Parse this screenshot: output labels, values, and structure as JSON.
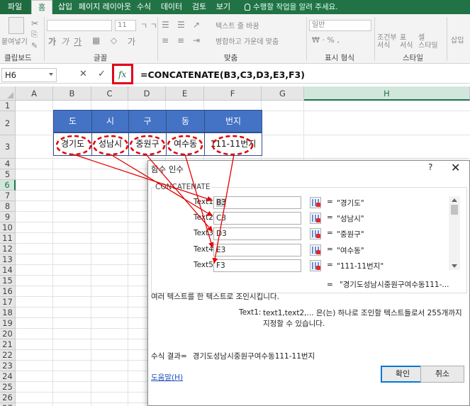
{
  "ribbon": {
    "tabs": [
      "파일",
      "홈",
      "삽입",
      "페이지 레이아웃",
      "수식",
      "데이터",
      "검토",
      "보기"
    ],
    "tell_me": "수행할 작업을 알려 주세요.",
    "font_name": "",
    "font_size": "11",
    "wrap_text": "텍스트 줄 바꿈",
    "merge_center": "병합하고 가운데 맞춤",
    "number_format": "일반",
    "paste": "붙여넣기",
    "conditional_format": "조건부\n서식",
    "format_as_table": "표\n서식",
    "cell_styles": "셀\n스타일",
    "insert": "삽입",
    "groups": {
      "clipboard": "클립보드",
      "font": "글꼴",
      "alignment": "맞춤",
      "number": "표시 형식",
      "styles": "스타일"
    }
  },
  "formula_bar": {
    "name_box": "H6",
    "cancel": "✕",
    "enter": "✓",
    "fx": "fx",
    "formula": "=CONCATENATE(B3,C3,D3,E3,F3)"
  },
  "sheet": {
    "columns": [
      "A",
      "B",
      "C",
      "D",
      "E",
      "F",
      "G",
      "H"
    ],
    "rows": [
      "1",
      "2",
      "3",
      "4",
      "5",
      "6",
      "7",
      "8",
      "9",
      "10",
      "11",
      "12",
      "13",
      "14",
      "15",
      "16",
      "17",
      "18",
      "19",
      "20",
      "21",
      "22",
      "23",
      "24",
      "25",
      "26",
      "27"
    ],
    "table_headers": [
      "도",
      "시",
      "구",
      "동",
      "번지"
    ],
    "table_values": [
      "경기도",
      "성남시",
      "중원구",
      "여수동",
      "111-11번지"
    ],
    "selected_cell": "H6",
    "accent": "#4472c4"
  },
  "dialog": {
    "title": "함수 인수",
    "help": "?",
    "close": "✕",
    "function_name": "CONCATENATE",
    "args": [
      {
        "label": "Text1",
        "ref": "B3",
        "value": "\"경기도\""
      },
      {
        "label": "Text2",
        "ref": "C3",
        "value": "\"성남시\""
      },
      {
        "label": "Text3",
        "ref": "D3",
        "value": "\"중원구\""
      },
      {
        "label": "Text4",
        "ref": "E3",
        "value": "\"여수동\""
      },
      {
        "label": "Text5",
        "ref": "F3",
        "value": "\"111-11번지\""
      }
    ],
    "equals": "=",
    "result_preview": "\"경기도성남시중원구여수동111-...",
    "description": "여러 텍스트를 한 텍스트로 조인시킵니다.",
    "arg_desc_name": "Text1:",
    "arg_desc": "text1,text2,... 은(는) 하나로 조인할 텍스트들로서 255개까지 지정할 수 있습니다.",
    "formula_result_label": "수식 결과=",
    "formula_result": "경기도성남시중원구여수동111-11번지",
    "help_link": "도움말(H)",
    "ok": "확인",
    "cancel": "취소"
  },
  "colors": {
    "ribbon_green": "#217346",
    "highlight_red": "#e3001b",
    "annotation_red": "#e30000"
  }
}
